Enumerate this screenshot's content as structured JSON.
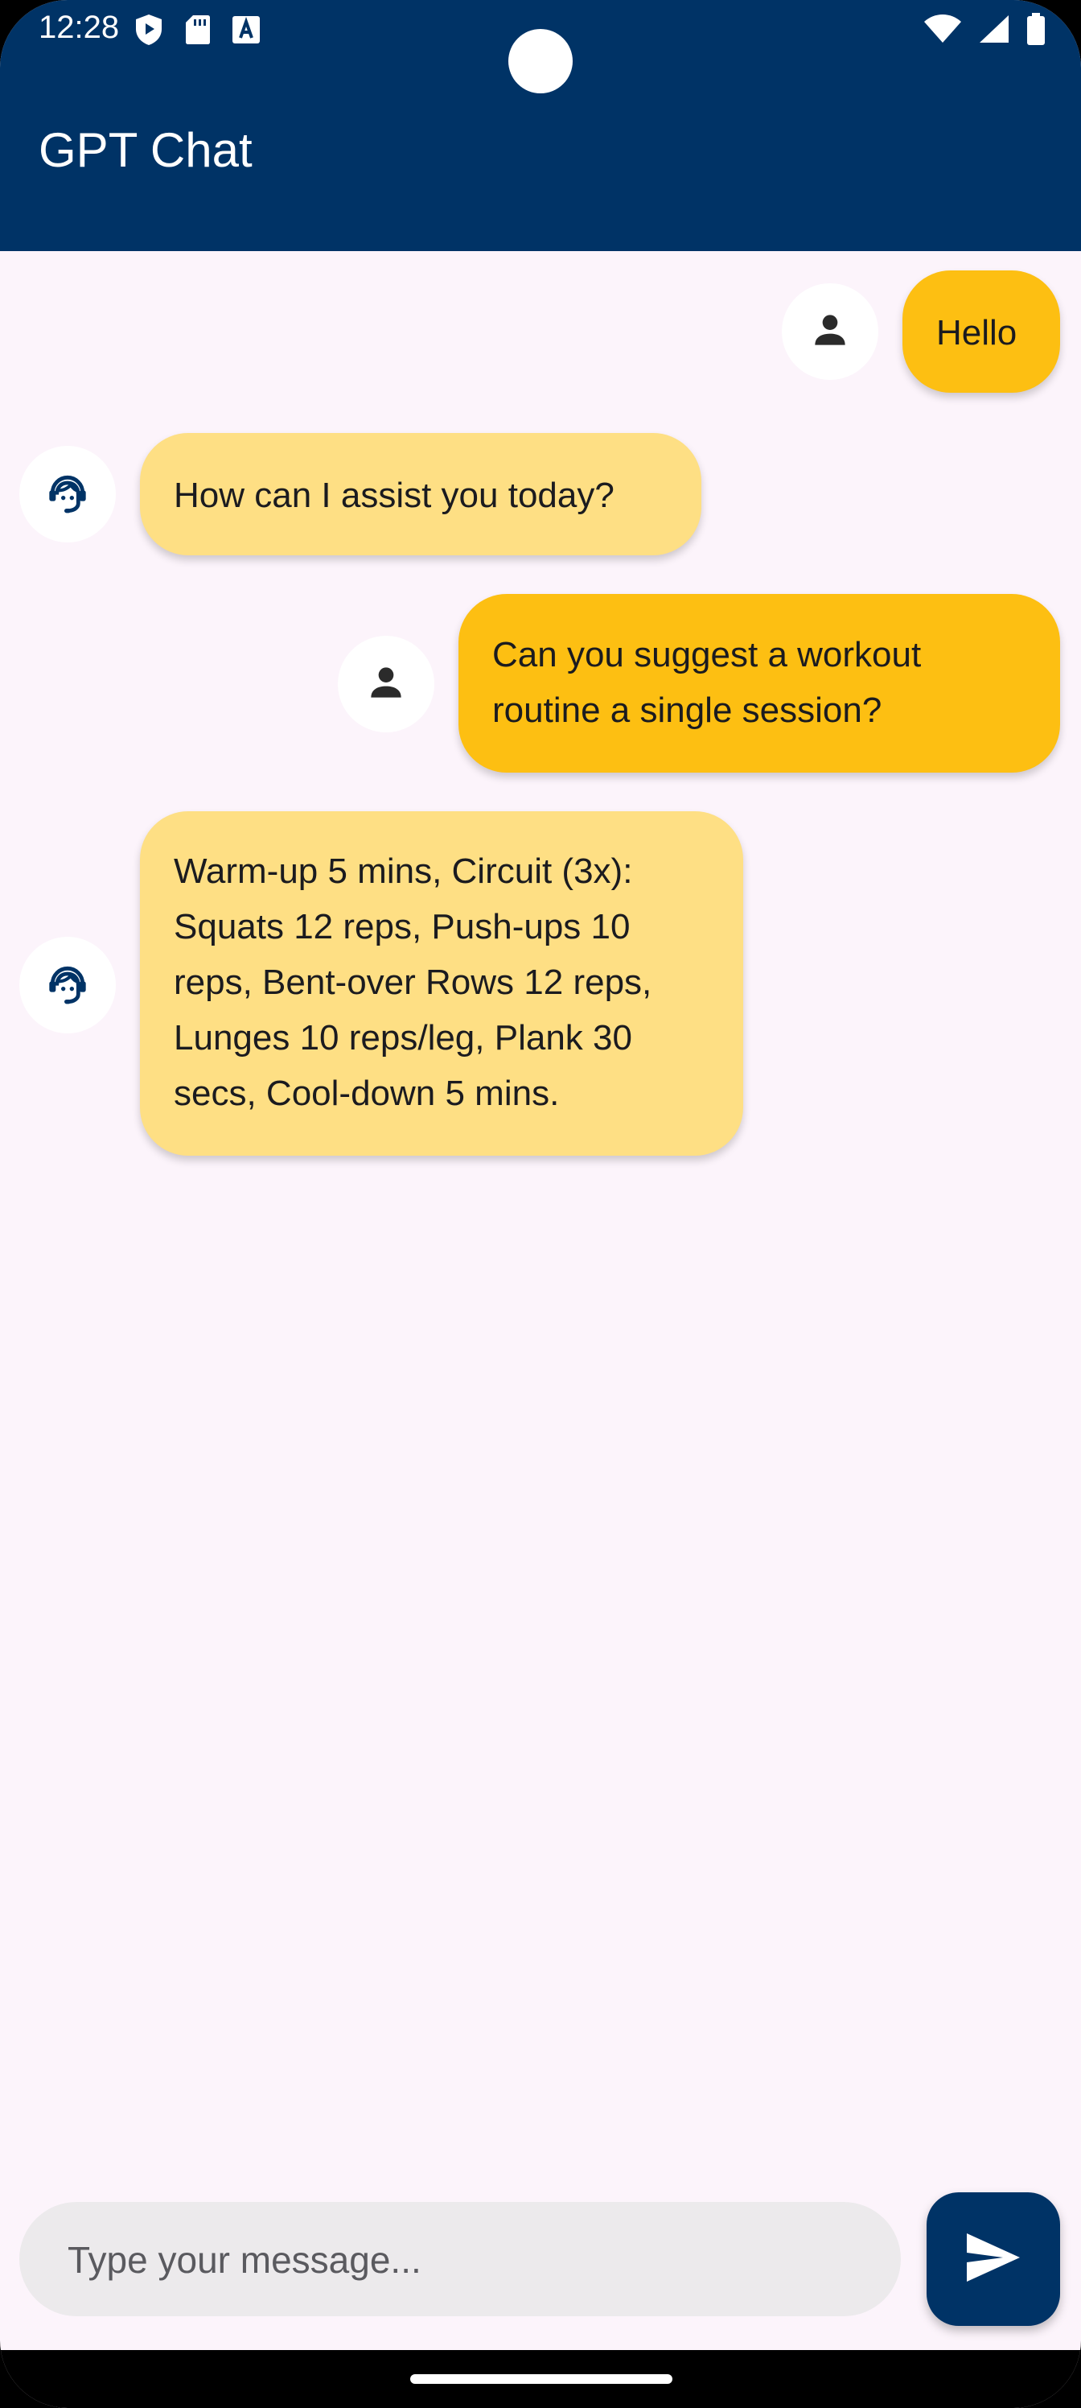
{
  "status_bar": {
    "time": "12:28"
  },
  "app_bar": {
    "title": "GPT Chat",
    "color": "#003366"
  },
  "messages": [
    {
      "role": "user",
      "text": "Hello"
    },
    {
      "role": "assistant",
      "text": "How can I assist you today?"
    },
    {
      "role": "user",
      "line1": "Can you suggest a workout",
      "line2": "routine a single session?"
    },
    {
      "role": "assistant",
      "line1": "Warm-up 5 mins, Circuit (3x):",
      "line2": "Squats 12 reps, Push-ups 10",
      "line3": "reps, Bent-over Rows 12 reps,",
      "line4": "Lunges 10 reps/leg, Plank 30",
      "line5": "secs, Cool-down 5 mins."
    }
  ],
  "composer": {
    "placeholder": "Type your message..."
  },
  "icons": {
    "user_avatar": "person-icon",
    "assistant_avatar": "support-agent-icon",
    "send": "send-icon"
  },
  "colors": {
    "user_bubble": "#fdbf12",
    "assistant_bubble": "#fedf84",
    "background": "#fcf4fb"
  }
}
